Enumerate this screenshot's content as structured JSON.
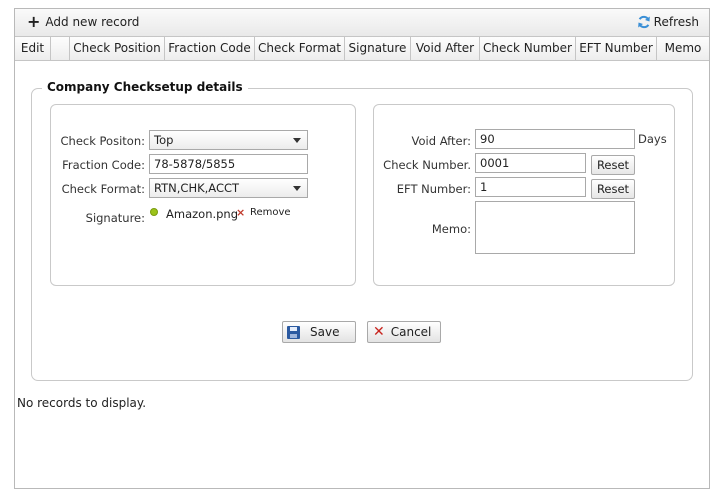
{
  "toolbar": {
    "add_label": "Add new record",
    "refresh_label": "Refresh"
  },
  "columns": [
    "Edit",
    "",
    "Check Position",
    "Fraction Code",
    "Check Format",
    "Signature",
    "Void After",
    "Check Number",
    "EFT Number",
    "Memo"
  ],
  "form": {
    "legend": "Company Checksetup details",
    "check_position": {
      "label": "Check Positon:",
      "value": "Top"
    },
    "fraction_code": {
      "label": "Fraction Code:",
      "value": "78-5878/5855"
    },
    "check_format": {
      "label": "Check Format:",
      "value": "RTN,CHK,ACCT"
    },
    "signature": {
      "label": "Signature:",
      "file": "Amazon.png",
      "remove_label": "Remove"
    },
    "void_after": {
      "label": "Void After:",
      "value": "90",
      "unit": "Days"
    },
    "check_number": {
      "label": "Check Number.",
      "value": "0001",
      "reset_label": "Reset"
    },
    "eft_number": {
      "label": "EFT Number:",
      "value": "1",
      "reset_label": "Reset"
    },
    "memo": {
      "label": "Memo:",
      "value": ""
    },
    "save_label": "Save",
    "cancel_label": "Cancel"
  },
  "grid": {
    "empty_message": "No records to display."
  },
  "colors": {
    "accent_green": "#9cc31a",
    "cancel_red": "#c8231d",
    "save_blue": "#2b5aa1",
    "refresh_blue": "#3a8fd6"
  }
}
